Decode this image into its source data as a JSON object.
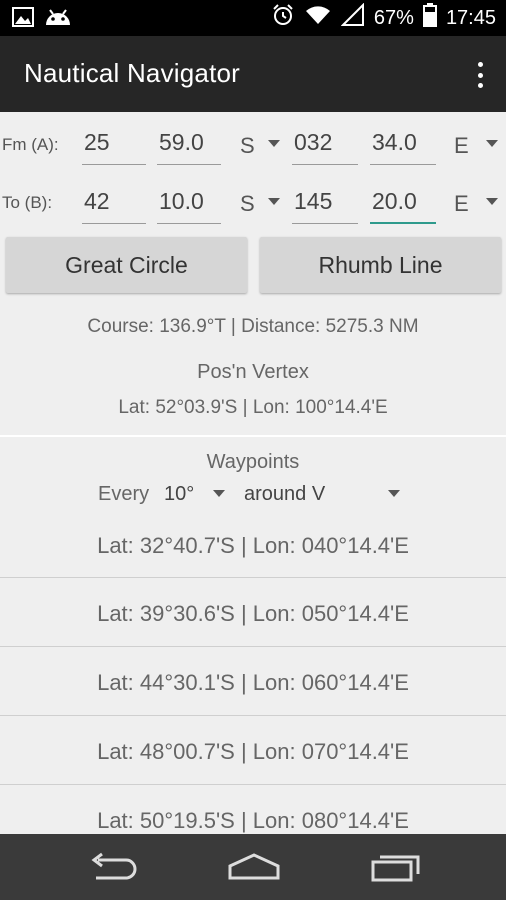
{
  "status_bar": {
    "battery": "67%",
    "time": "17:45",
    "icons": [
      "image-icon",
      "android-icon",
      "alarm-icon",
      "wifi-icon",
      "signal-icon",
      "battery-icon"
    ]
  },
  "app_bar": {
    "title": "Nautical Navigator"
  },
  "from": {
    "label": "Fm (A):",
    "lat_deg": "25",
    "lat_min": "59.0",
    "lat_hemi": "S",
    "lon_deg": "032",
    "lon_min": "34.0",
    "lon_hemi": "E"
  },
  "to": {
    "label": "To (B):",
    "lat_deg": "42",
    "lat_min": "10.0",
    "lat_hemi": "S",
    "lon_deg": "145",
    "lon_min": "20.0",
    "lon_hemi": "E"
  },
  "buttons": {
    "great_circle": "Great Circle",
    "rhumb_line": "Rhumb Line"
  },
  "result": {
    "course_distance": "Course: 136.9°T | Distance: 5275.3 NM",
    "vertex_title": "Pos'n Vertex",
    "vertex_pos": "Lat: 52°03.9'S | Lon: 100°14.4'E"
  },
  "waypoints": {
    "title": "Waypoints",
    "every_label": "Every",
    "interval": "10°",
    "mode": "around V",
    "items": [
      "Lat: 32°40.7'S | Lon: 040°14.4'E",
      "Lat: 39°30.6'S | Lon: 050°14.4'E",
      "Lat: 44°30.1'S | Lon: 060°14.4'E",
      "Lat: 48°00.7'S | Lon: 070°14.4'E",
      "Lat: 50°19.5'S | Lon: 080°14.4'E"
    ]
  },
  "colors": {
    "accent": "#2e9a8c",
    "appbar": "#262626",
    "background": "#efefef"
  }
}
